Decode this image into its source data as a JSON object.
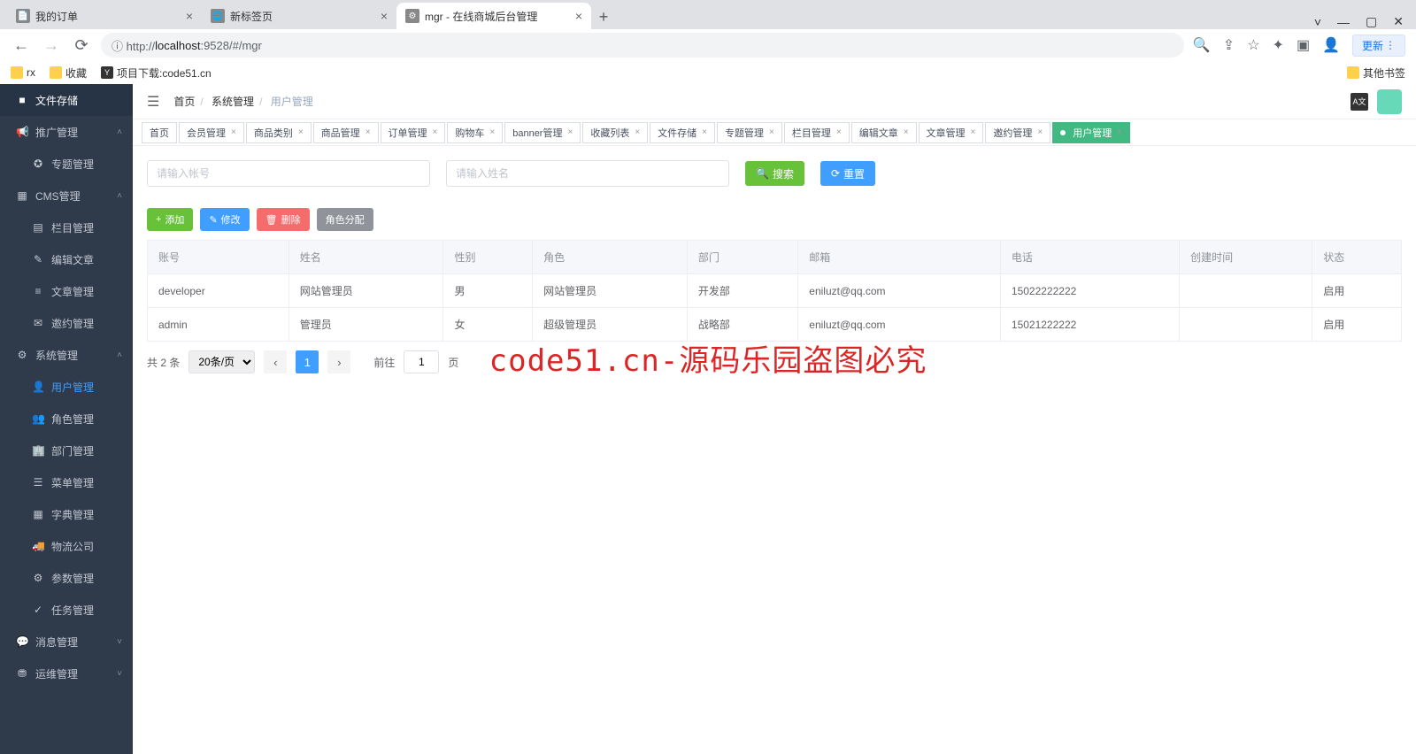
{
  "browser": {
    "tabs": [
      {
        "title": "我的订单"
      },
      {
        "title": "新标签页"
      },
      {
        "title": "mgr - 在线商城后台管理"
      }
    ],
    "url_proto": "ⓘ http://",
    "url_host": "localhost",
    "url_path": ":9528/#/mgr",
    "update": "更新",
    "bookmarks": {
      "rx": "rx",
      "fav": "收藏",
      "proj": "项目下载:code51.cn",
      "other": "其他书签"
    }
  },
  "sidebar": {
    "items": [
      {
        "ic": "■",
        "label": "文件存储"
      },
      {
        "ic": "📢",
        "label": "推广管理",
        "chev": "˄"
      },
      {
        "ic": "✪",
        "label": "专题管理",
        "sub": true
      },
      {
        "ic": "▦",
        "label": "CMS管理",
        "chev": "˄"
      },
      {
        "ic": "▤",
        "label": "栏目管理",
        "sub": true
      },
      {
        "ic": "✎",
        "label": "编辑文章",
        "sub": true
      },
      {
        "ic": "≡",
        "label": "文章管理",
        "sub": true
      },
      {
        "ic": "✉",
        "label": "邀约管理",
        "sub": true
      },
      {
        "ic": "⚙",
        "label": "系统管理",
        "chev": "˄"
      },
      {
        "ic": "👤",
        "label": "用户管理",
        "sub": true,
        "active": true
      },
      {
        "ic": "👥",
        "label": "角色管理",
        "sub": true
      },
      {
        "ic": "🏢",
        "label": "部门管理",
        "sub": true
      },
      {
        "ic": "☰",
        "label": "菜单管理",
        "sub": true
      },
      {
        "ic": "▦",
        "label": "字典管理",
        "sub": true
      },
      {
        "ic": "🚚",
        "label": "物流公司",
        "sub": true
      },
      {
        "ic": "⚙",
        "label": "参数管理",
        "sub": true
      },
      {
        "ic": "✓",
        "label": "任务管理",
        "sub": true
      },
      {
        "ic": "💬",
        "label": "消息管理",
        "chev": "˅"
      },
      {
        "ic": "⛃",
        "label": "运维管理",
        "chev": "˅"
      }
    ]
  },
  "breadcrumb": {
    "home": "首页",
    "sys": "系统管理",
    "cur": "用户管理"
  },
  "viewtabs": [
    "首页",
    "会员管理",
    "商品类别",
    "商品管理",
    "订单管理",
    "购物车",
    "banner管理",
    "收藏列表",
    "文件存储",
    "专题管理",
    "栏目管理",
    "编辑文章",
    "文章管理",
    "邀约管理",
    "用户管理"
  ],
  "search": {
    "ph_account": "请输入帐号",
    "ph_name": "请输入姓名",
    "btn_search": "搜索",
    "btn_reset": "重置"
  },
  "actions": {
    "add": "添加",
    "edit": "修改",
    "del": "删除",
    "role": "角色分配"
  },
  "table": {
    "headers": [
      "账号",
      "姓名",
      "性别",
      "角色",
      "部门",
      "邮箱",
      "电话",
      "创建时间",
      "状态"
    ],
    "rows": [
      [
        "developer",
        "网站管理员",
        "男",
        "网站管理员",
        "开发部",
        "eniluzt@qq.com",
        "15022222222",
        "",
        "启用"
      ],
      [
        "admin",
        "管理员",
        "女",
        "超级管理员",
        "战略部",
        "eniluzt@qq.com",
        "15021222222",
        "",
        "启用"
      ]
    ]
  },
  "pager": {
    "total": "共 2 条",
    "size": "20条/页",
    "goto": "前往",
    "page": "1",
    "unit": "页"
  },
  "watermark": "code51.cn-源码乐园盗图必究"
}
